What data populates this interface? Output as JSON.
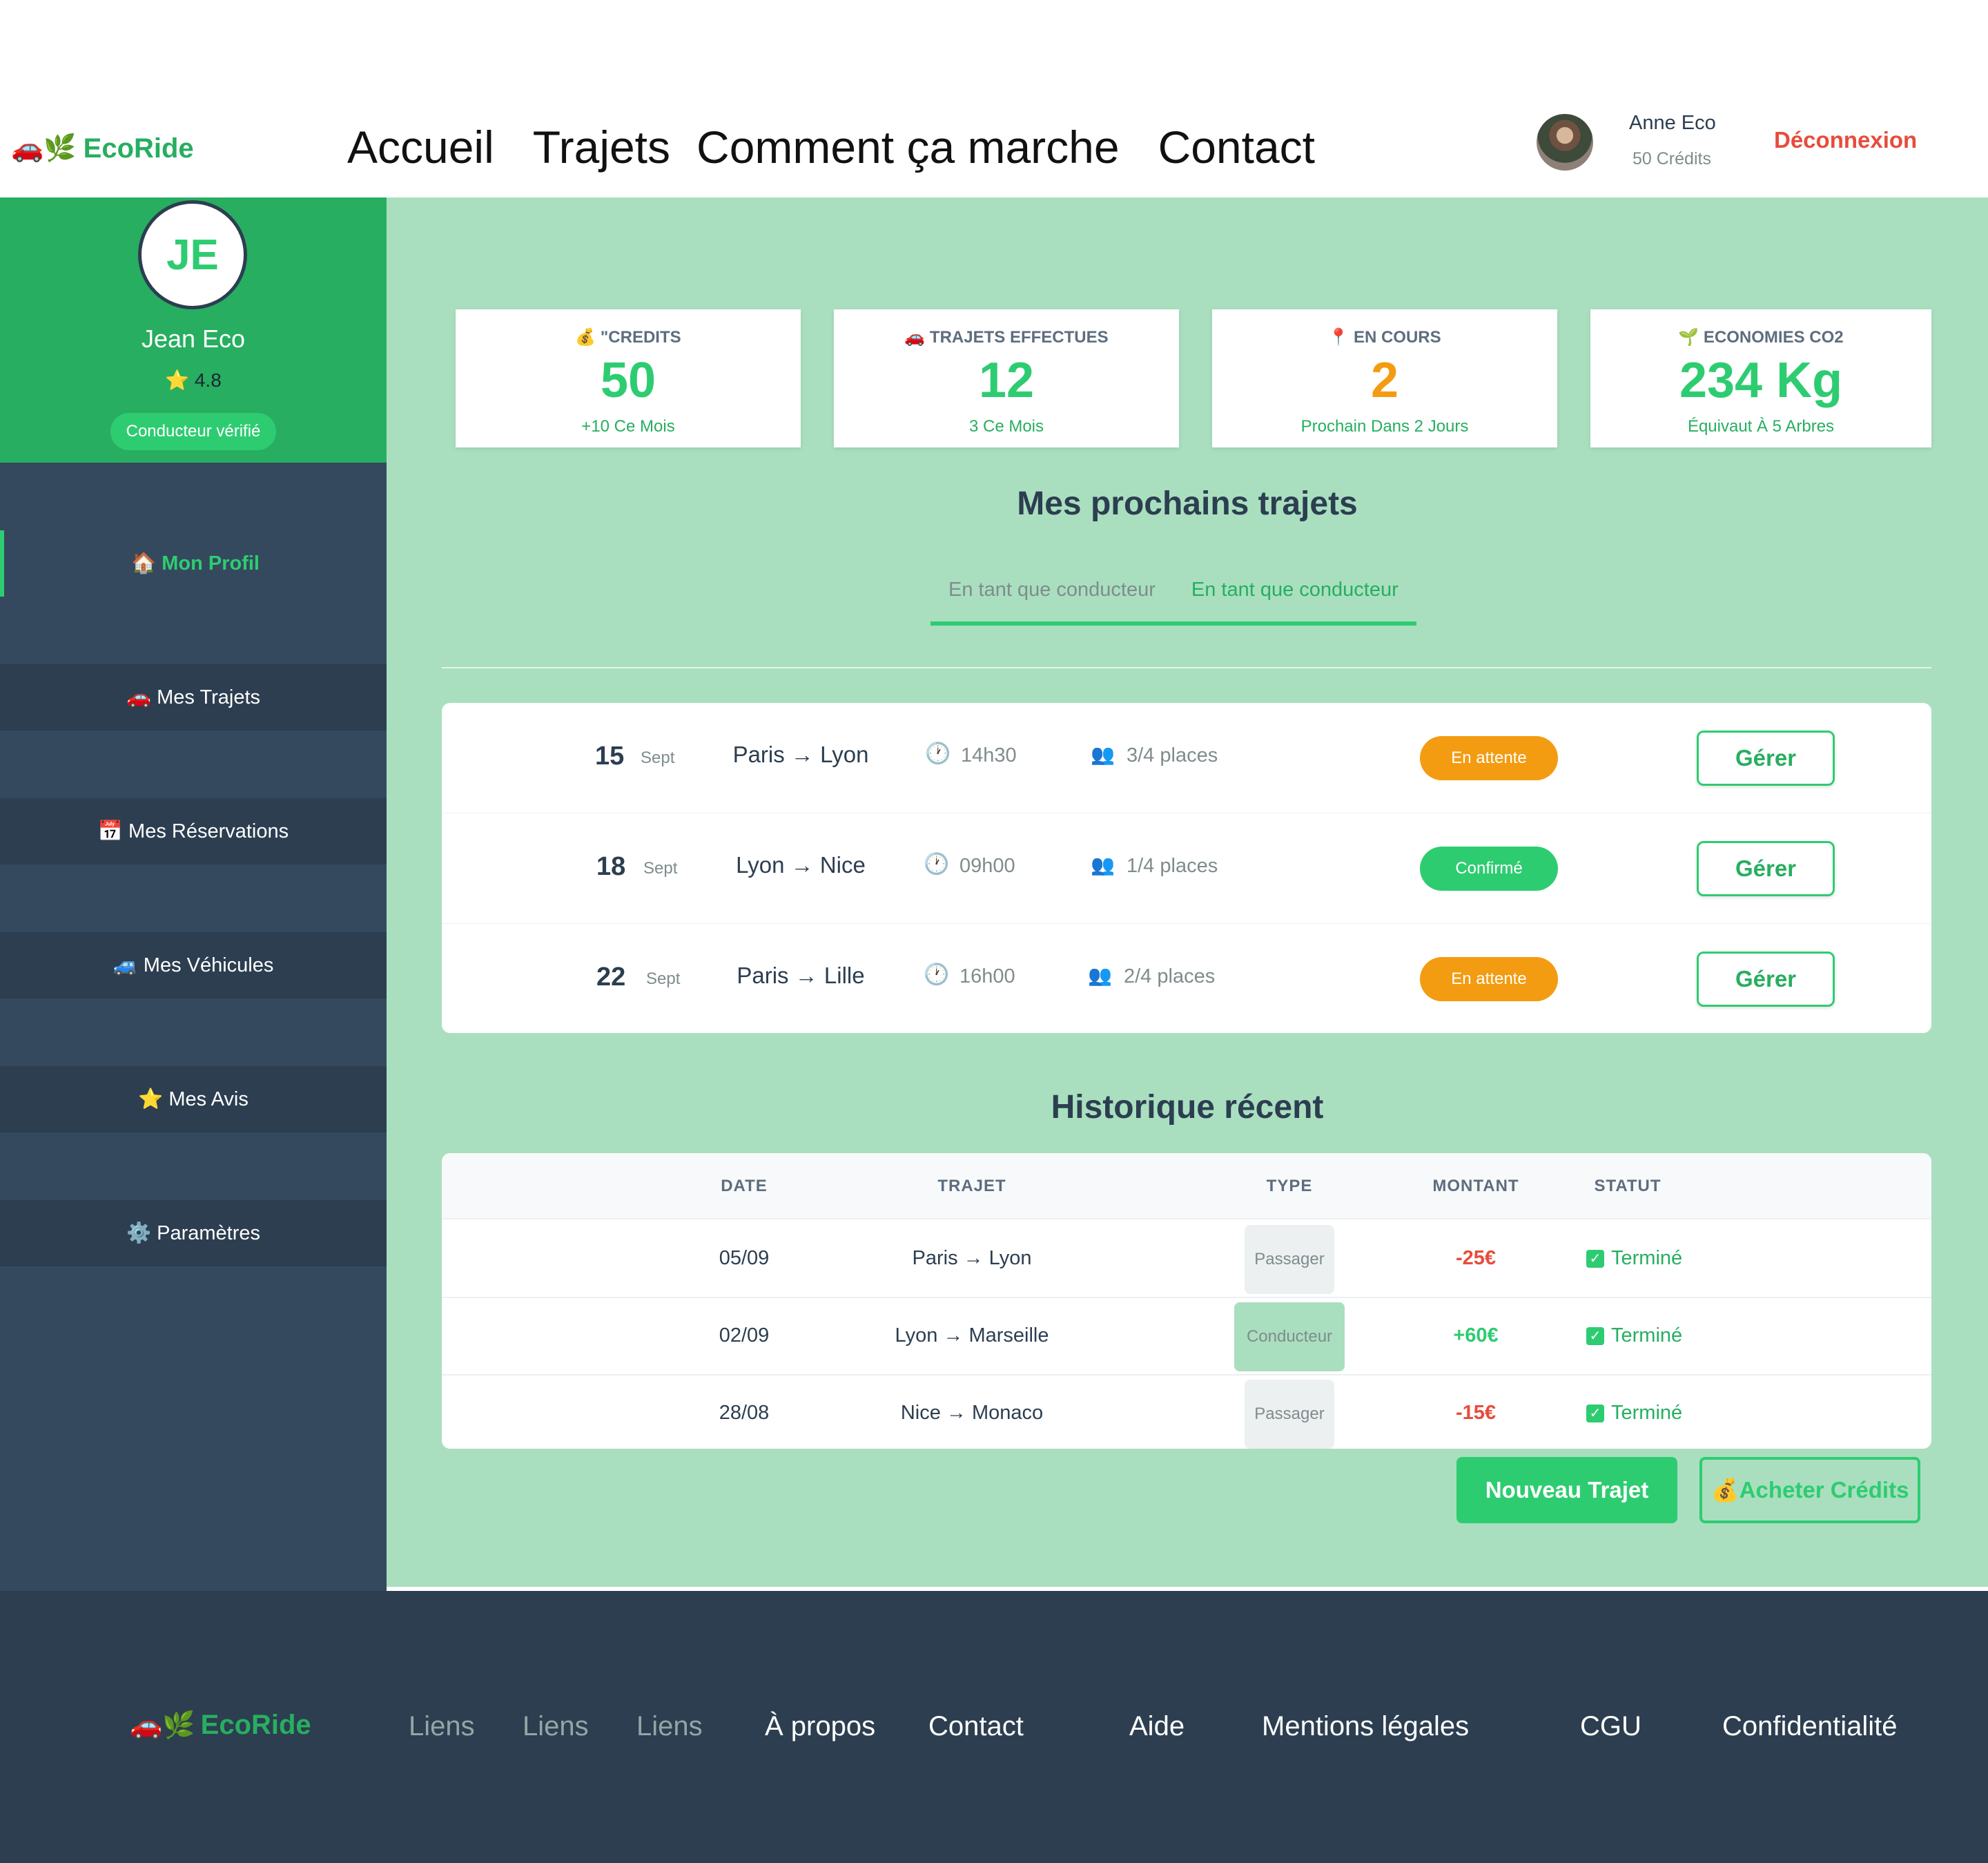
{
  "header": {
    "logo_icons": "🚗🌿",
    "logo": "EcoRide",
    "nav": [
      "Accueil",
      "Trajets",
      "Comment ça marche",
      "Contact"
    ],
    "user_name": "Anne Eco",
    "user_credits": "50 Crédits",
    "logout": "Déconnexion"
  },
  "sidebar": {
    "initials": "JE",
    "name": "Jean Eco",
    "rating_star": "⭐",
    "rating": "4.8",
    "verified": "Conducteur vérifié",
    "items": [
      {
        "icon": "🏠",
        "label": "Mon Profil"
      },
      {
        "icon": "🚗",
        "label": "Mes Trajets"
      },
      {
        "icon": "📅",
        "label": "Mes Réservations"
      },
      {
        "icon": "🚙",
        "label": "Mes Véhicules"
      },
      {
        "icon": "⭐",
        "label": "Mes Avis"
      },
      {
        "icon": "⚙️",
        "label": "Paramètres"
      }
    ]
  },
  "stats": [
    {
      "icon": "💰",
      "label": "\"CREDITS",
      "value": "50",
      "sub": "+10 Ce Mois"
    },
    {
      "icon": "🚗",
      "label": "TRAJETS EFFECTUES",
      "value": "12",
      "sub": "3 Ce Mois"
    },
    {
      "icon": "📍",
      "label": "EN COURS",
      "value": "2",
      "sub": "Prochain Dans 2 Jours"
    },
    {
      "icon": "🌱",
      "label": "ECONOMIES CO2",
      "value": "234 Kg",
      "sub": "Équivaut À 5 Arbres"
    }
  ],
  "upcoming": {
    "title": "Mes prochains trajets",
    "tabs": [
      "En tant que conducteur",
      "En tant que conducteur"
    ],
    "trips": [
      {
        "day": "15",
        "month": "Sept",
        "route": "Paris → Lyon",
        "time": "14h30",
        "places": "3/4 places",
        "status": "En attente",
        "action": "Gérer"
      },
      {
        "day": "18",
        "month": "Sept",
        "route": "Lyon → Nice",
        "time": "09h00",
        "places": "1/4 places",
        "status": "Confirmé",
        "action": "Gérer"
      },
      {
        "day": "22",
        "month": "Sept",
        "route": "Paris → Lille",
        "time": "16h00",
        "places": "2/4 places",
        "status": "En attente",
        "action": "Gérer"
      }
    ]
  },
  "history": {
    "title": "Historique récent",
    "columns": [
      "DATE",
      "TRAJET",
      "TYPE",
      "MONTANT",
      "STATUT"
    ],
    "rows": [
      {
        "date": "05/09",
        "route": "Paris → Lyon",
        "type": "Passager",
        "amount": "-25€",
        "status": "Terminé"
      },
      {
        "date": "02/09",
        "route": "Lyon → Marseille",
        "type": "Conducteur",
        "amount": "+60€",
        "status": "Terminé"
      },
      {
        "date": "28/08",
        "route": "Nice → Monaco",
        "type": "Passager",
        "amount": "-15€",
        "status": "Terminé"
      }
    ]
  },
  "actions": {
    "new_trip": "Nouveau Trajet",
    "buy_icon": "💰",
    "buy_credits": "Acheter Crédits"
  },
  "footer": {
    "logo_icons": "🚗🌿",
    "logo": "EcoRide",
    "links": [
      "Liens",
      "Liens",
      "Liens",
      "À propos",
      "Contact",
      "Aide",
      "Mentions légales",
      "CGU",
      "Confidentialité"
    ]
  }
}
